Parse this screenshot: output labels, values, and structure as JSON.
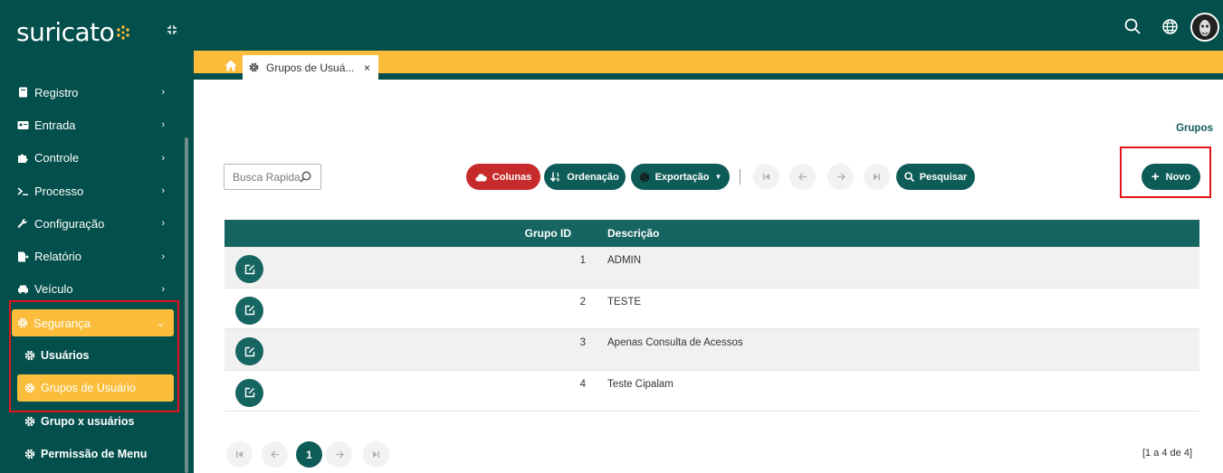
{
  "app": {
    "logo_text": "suricato"
  },
  "sidebar": {
    "items": [
      {
        "label": "Registro",
        "icon": "book-icon"
      },
      {
        "label": "Entrada",
        "icon": "id-card-icon"
      },
      {
        "label": "Controle",
        "icon": "puzzle-icon"
      },
      {
        "label": "Processo",
        "icon": "terminal-icon"
      },
      {
        "label": "Configuração",
        "icon": "wrench-icon"
      },
      {
        "label": "Relatório",
        "icon": "file-export-icon"
      },
      {
        "label": "Veículo",
        "icon": "car-icon"
      }
    ],
    "security": {
      "label": "Segurança",
      "icon": "gear-icon",
      "children": [
        {
          "label": "Usuários",
          "active": false
        },
        {
          "label": "Grupos de Usuário",
          "active": true
        },
        {
          "label": "Grupo x usuários",
          "active": false
        },
        {
          "label": "Permissão de Menu",
          "active": false
        }
      ]
    }
  },
  "tabs": {
    "active_tab_label": "Grupos de Usuá...",
    "close_glyph": "×"
  },
  "breadcrumb": "Grupos",
  "toolbar": {
    "search_placeholder": "Busca Rapida",
    "colunas": "Colunas",
    "ordenacao": "Ordenação",
    "exportacao": "Exportação",
    "pesquisar": "Pesquisar",
    "novo": "Novo"
  },
  "table": {
    "headers": {
      "id": "Grupo ID",
      "desc": "Descrição"
    },
    "rows": [
      {
        "id": "1",
        "desc": "ADMIN"
      },
      {
        "id": "2",
        "desc": "TESTE"
      },
      {
        "id": "3",
        "desc": "Apenas Consulta de Acessos"
      },
      {
        "id": "4",
        "desc": "Teste Cipalam"
      }
    ]
  },
  "pagination": {
    "current_page": "1",
    "info": "[1 a 4 de 4]"
  },
  "colors": {
    "dark_teal": "#034f4b",
    "teal": "#0e5c57",
    "accent_yellow": "#fbbd3b",
    "red": "#c62a2a",
    "highlight_border": "#e0141b"
  }
}
